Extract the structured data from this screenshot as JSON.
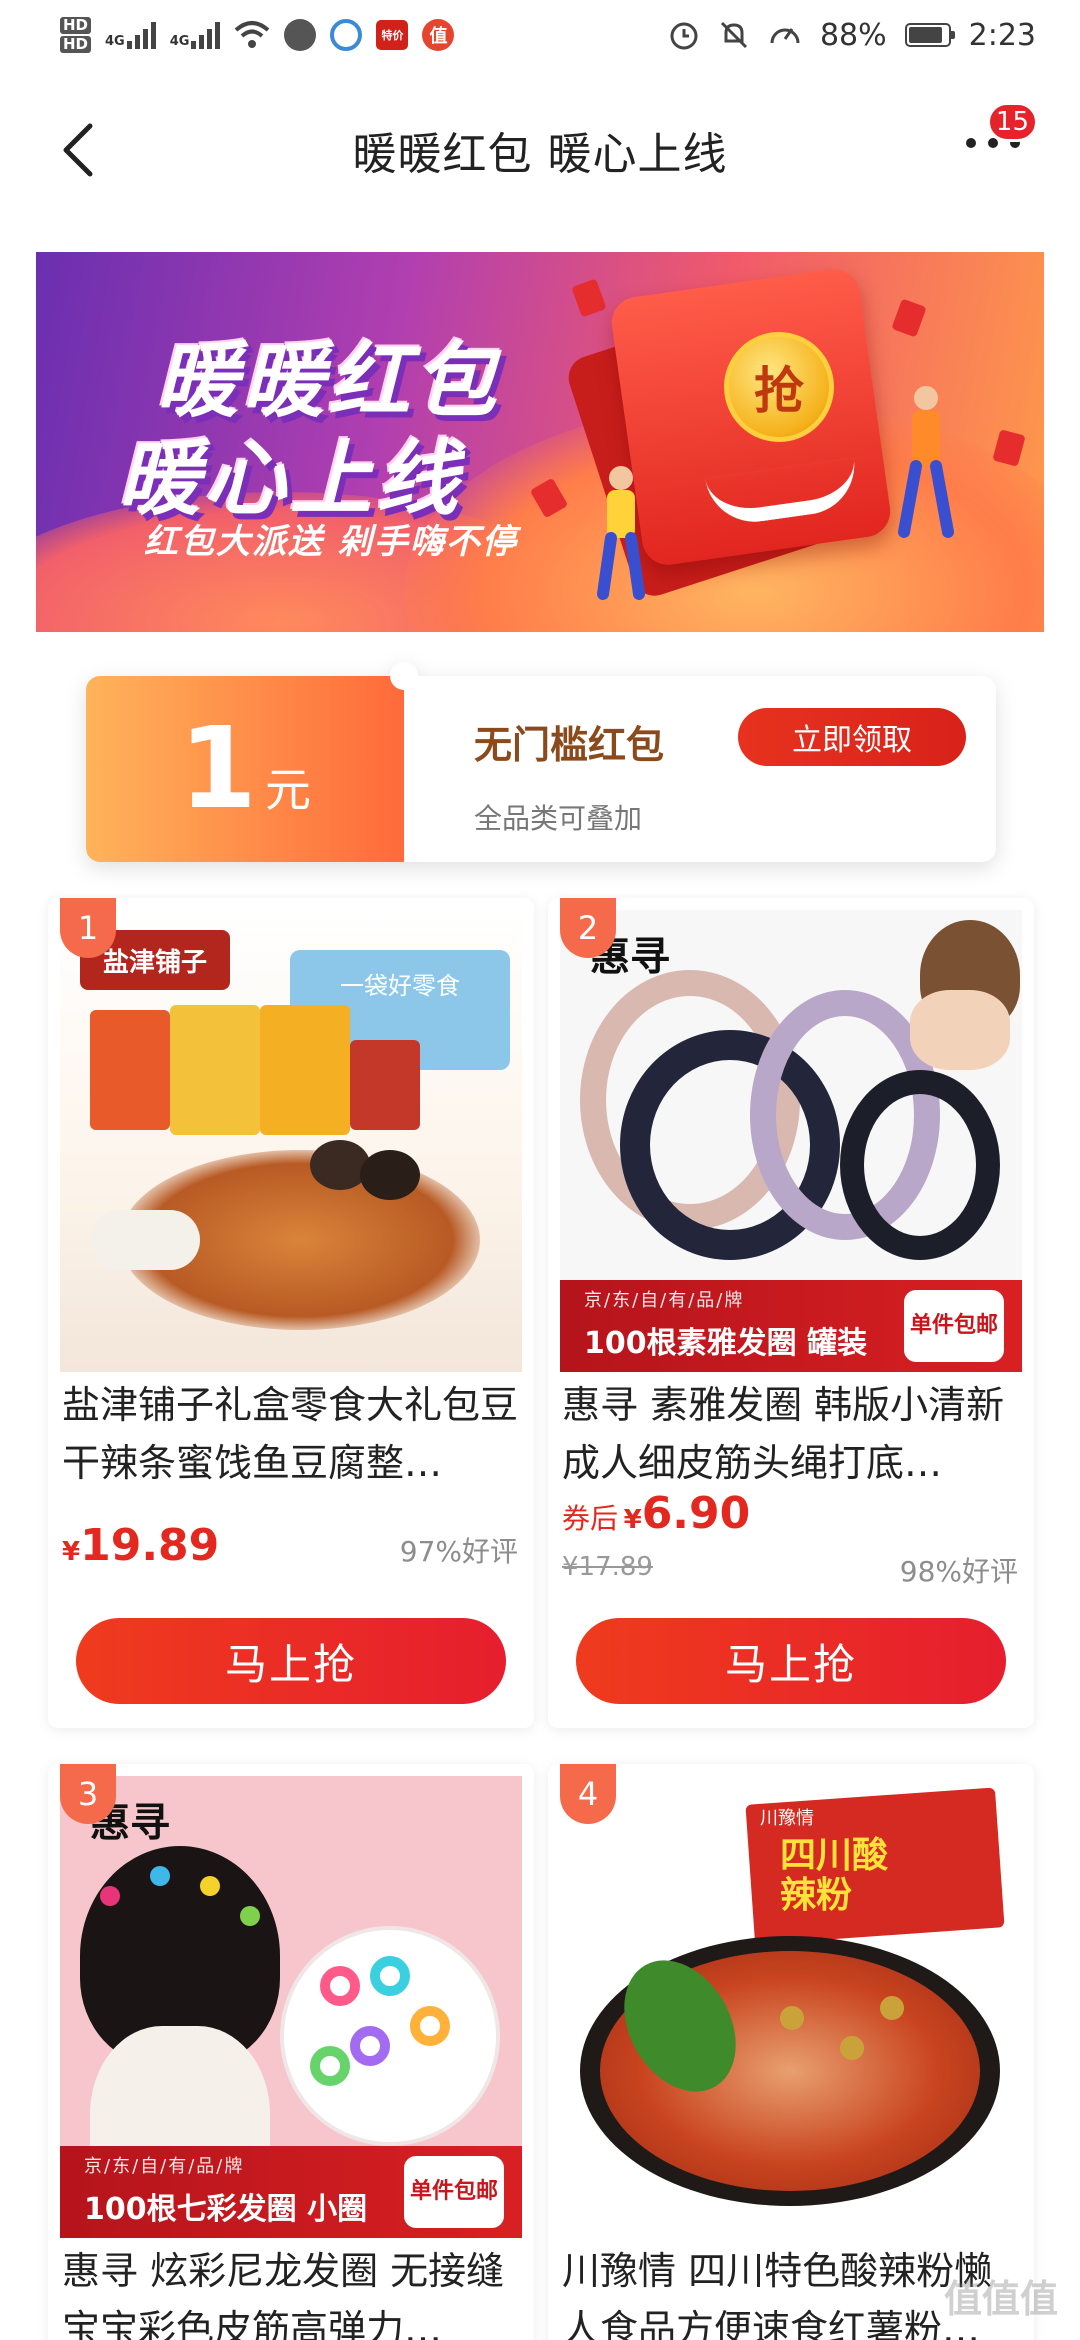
{
  "status_bar": {
    "hd1": "HD",
    "hd2": "HD",
    "net1": "4G",
    "net2": "4G",
    "app_label": "特价",
    "zhi_label": "值",
    "battery": "88%",
    "time": "2:23"
  },
  "header": {
    "title": "暖暖红包 暖心上线",
    "badge_count": "15"
  },
  "banner": {
    "line1": "暖暖红包",
    "line2": "暖心上线",
    "subtitle": "红包大派送 剁手嗨不停",
    "coin_label": "抢"
  },
  "coupon": {
    "amount": "1",
    "unit": "元",
    "name": "无门槛红包",
    "desc": "全品类可叠加",
    "button": "立即领取"
  },
  "products": [
    {
      "rank": "1",
      "title": "盐津铺子礼盒零食大礼包豆干辣条蜜饯鱼豆腐整…",
      "currency": "¥",
      "price": "19.89",
      "rating": "97%好评",
      "button": "马上抢",
      "img_text": "盐津铺子",
      "img_sub": "一袋好零食"
    },
    {
      "rank": "2",
      "title": "惠寻 素雅发圈 韩版小清新成人细皮筋头绳打底…",
      "price_label": "券后",
      "currency": "¥",
      "price": "6.90",
      "old_price": "¥17.89",
      "rating": "98%好评",
      "button": "马上抢",
      "strip_top": "京/东/自/有/品/牌",
      "strip_main": "100根素雅发圈 罐装",
      "strip_tag": "单件包邮",
      "img_text": "惠寻"
    },
    {
      "rank": "3",
      "title": "惠寻 炫彩尼龙发圈 无接缝宝宝彩色皮筋高弹力…",
      "strip_top": "京/东/自/有/品/牌",
      "strip_main": "100根七彩发圈 小圈",
      "strip_tag": "单件包邮",
      "img_text": "惠寻"
    },
    {
      "rank": "4",
      "title": "川豫情 四川特色酸辣粉懒人食品方便速食红薯粉…",
      "img_brand": "川豫情",
      "img_text": "四川酸辣粉"
    }
  ],
  "watermark": "值值值",
  "colors": {
    "accent": "#e3281f",
    "rank_badge": "#f56a4a",
    "button": "#e8321f"
  }
}
